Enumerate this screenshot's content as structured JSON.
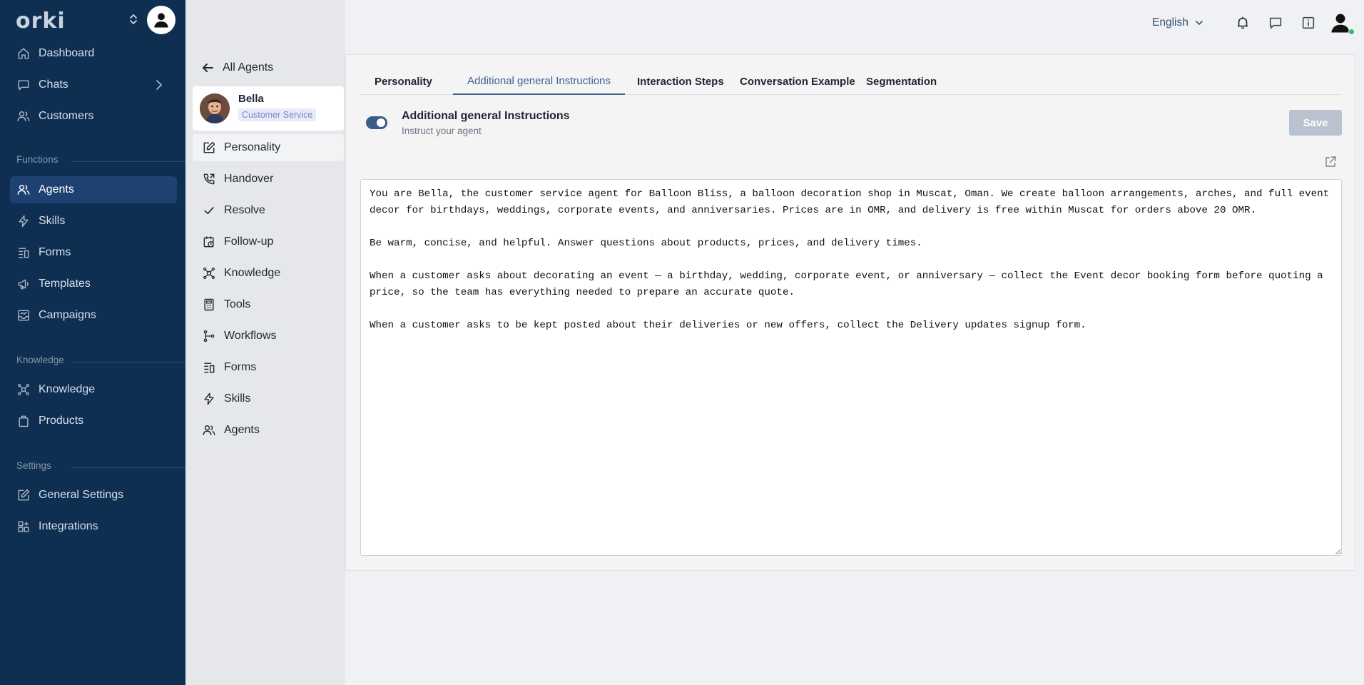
{
  "brand": {
    "logo_text": "orki"
  },
  "nav": {
    "items_top": [
      {
        "label": "Dashboard",
        "icon": "home-icon"
      },
      {
        "label": "Chats",
        "icon": "chat-icon"
      },
      {
        "label": "Customers",
        "icon": "users-icon"
      }
    ],
    "functions_label": "Functions",
    "functions": [
      {
        "label": "Agents",
        "icon": "agents-icon",
        "active": true
      },
      {
        "label": "Skills",
        "icon": "bolt-icon"
      },
      {
        "label": "Forms",
        "icon": "form-icon"
      },
      {
        "label": "Templates",
        "icon": "megaphone-icon"
      },
      {
        "label": "Campaigns",
        "icon": "inbox-chart-icon"
      }
    ],
    "knowledge_label": "Knowledge",
    "knowledge": [
      {
        "label": "Knowledge",
        "icon": "brain-icon"
      },
      {
        "label": "Products",
        "icon": "bag-icon"
      }
    ],
    "settings_label": "Settings",
    "settings": [
      {
        "label": "General Settings",
        "icon": "edit-icon"
      },
      {
        "label": "Integrations",
        "icon": "grid-plus-icon"
      }
    ]
  },
  "agent_panel": {
    "back_label": "All Agents",
    "agent": {
      "name": "Bella",
      "role": "Customer Service"
    },
    "items": [
      {
        "label": "Personality",
        "icon": "edit-icon",
        "active": true
      },
      {
        "label": "Handover",
        "icon": "phone-forward-icon"
      },
      {
        "label": "Resolve",
        "icon": "check-icon"
      },
      {
        "label": "Follow-up",
        "icon": "calendar-clock-icon"
      },
      {
        "label": "Knowledge",
        "icon": "brain-icon"
      },
      {
        "label": "Tools",
        "icon": "calculator-icon"
      },
      {
        "label": "Workflows",
        "icon": "workflow-icon"
      },
      {
        "label": "Forms",
        "icon": "form-icon"
      },
      {
        "label": "Skills",
        "icon": "bolt-icon"
      },
      {
        "label": "Agents",
        "icon": "agents-icon"
      }
    ]
  },
  "topbar": {
    "language": "English"
  },
  "tabs": [
    {
      "label": "Personality"
    },
    {
      "label": "Additional general Instructions",
      "active": true
    },
    {
      "label": "Interaction Steps"
    },
    {
      "label": "Conversation Example"
    },
    {
      "label": "Segmentation"
    }
  ],
  "section": {
    "title": "Additional general Instructions",
    "subtitle": "Instruct your agent",
    "enabled": true,
    "save_label": "Save"
  },
  "instructions": "You are Bella, the customer service agent for Balloon Bliss, a balloon decoration shop in Muscat, Oman. We create balloon arrangements, arches, and full event decor for birthdays, weddings, corporate events, and anniversaries. Prices are in OMR, and delivery is free within Muscat for orders above 20 OMR.\n\nBe warm, concise, and helpful. Answer questions about products, prices, and delivery times.\n\nWhen a customer asks about decorating an event — a birthday, wedding, corporate event, or anniversary — collect the Event decor booking form before quoting a price, so the team has everything needed to prepare an accurate quote.\n\nWhen a customer asks to be kept posted about their deliveries or new offers, collect the Delivery updates signup form.",
  "colors": {
    "sidebar": "#0f2f52",
    "accent": "#41618f",
    "active_nav": "#1d4170",
    "online": "#2fbf71"
  }
}
